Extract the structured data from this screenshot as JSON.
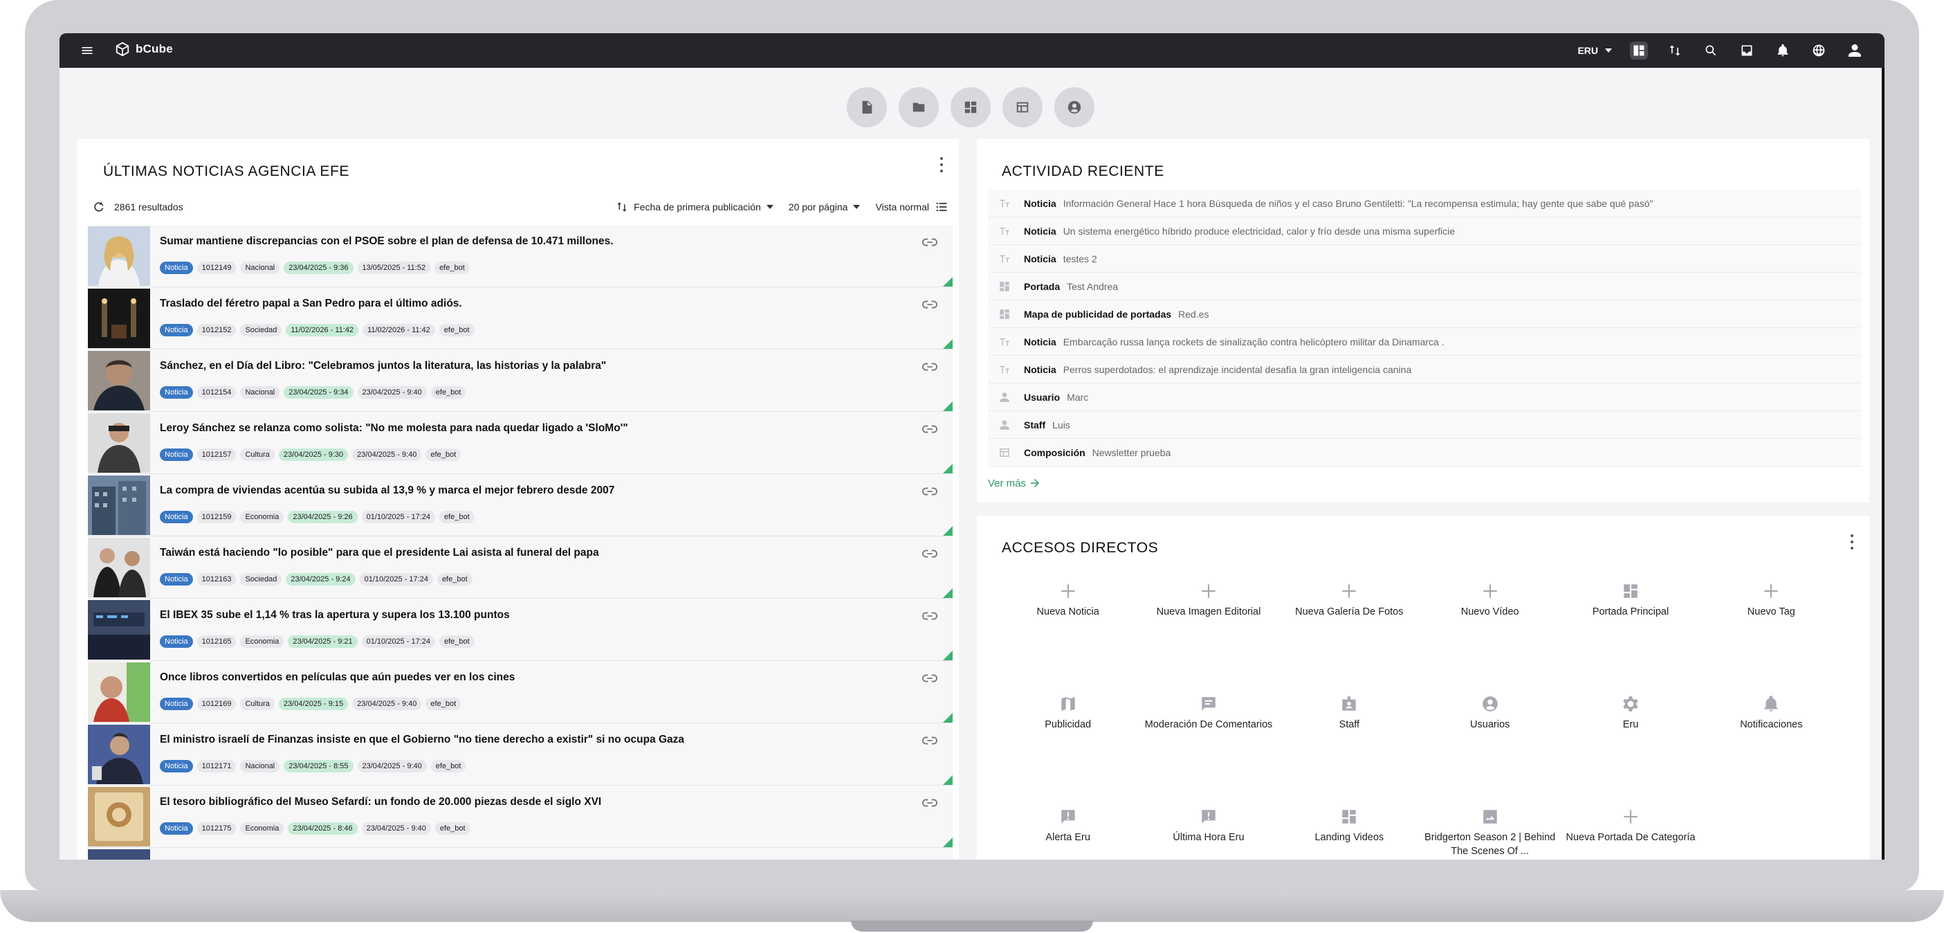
{
  "topbar": {
    "brand": "bCube",
    "site_selector": "ERU",
    "icons": [
      "layout-icon",
      "sort-icon",
      "search-icon",
      "inbox-icon",
      "bell-icon",
      "globe-icon",
      "account-icon"
    ]
  },
  "quick_buttons": [
    "document-icon",
    "folder-icon",
    "dashboard-icon",
    "table-icon",
    "user-circle-icon"
  ],
  "news": {
    "title": "ÚLTIMAS NOTICIAS AGENCIA EFE",
    "results": "2861 resultados",
    "sort_label": "Fecha de primera publicación",
    "per_page": "20 por página",
    "view": "Vista normal",
    "items": [
      {
        "title": "Sumar mantiene discrepancias con el PSOE sobre el plan de defensa de 10.471 millones.",
        "type": "Noticia",
        "id": "1012149",
        "section": "Nacional",
        "date1": "23/04/2025 - 9:36",
        "date2": "13/05/2025 - 11:52",
        "user": "efe_bot"
      },
      {
        "title": "Traslado del féretro papal a San Pedro para el último adiós.",
        "type": "Noticia",
        "id": "1012152",
        "section": "Sociedad",
        "date1": "11/02/2026 - 11:42",
        "date2": "11/02/2026 - 11:42",
        "user": "efe_bot"
      },
      {
        "title": "Sánchez, en el Día del Libro: \"Celebramos juntos la literatura, las historias y la palabra\"",
        "type": "Noticia",
        "id": "1012154",
        "section": "Nacional",
        "date1": "23/04/2025 - 9:34",
        "date2": "23/04/2025 - 9:40",
        "user": "efe_bot"
      },
      {
        "title": "Leroy Sánchez se relanza como solista: \"No me molesta para nada quedar ligado a 'SloMo'\"",
        "type": "Noticia",
        "id": "1012157",
        "section": "Cultura",
        "date1": "23/04/2025 - 9:30",
        "date2": "23/04/2025 - 9:40",
        "user": "efe_bot"
      },
      {
        "title": "La compra de viviendas acentúa su subida al 13,9 % y marca el mejor febrero desde 2007",
        "type": "Noticia",
        "id": "1012159",
        "section": "Economia",
        "date1": "23/04/2025 - 9:26",
        "date2": "01/10/2025 - 17:24",
        "user": "efe_bot"
      },
      {
        "title": "Taiwán está haciendo \"lo posible\" para que el presidente Lai asista al funeral del papa",
        "type": "Noticia",
        "id": "1012163",
        "section": "Sociedad",
        "date1": "23/04/2025 - 9:24",
        "date2": "01/10/2025 - 17:24",
        "user": "efe_bot"
      },
      {
        "title": "El IBEX 35 sube el 1,14 % tras la apertura y supera los 13.100 puntos",
        "type": "Noticia",
        "id": "1012165",
        "section": "Economia",
        "date1": "23/04/2025 - 9:21",
        "date2": "01/10/2025 - 17:24",
        "user": "efe_bot"
      },
      {
        "title": "Once libros convertidos en películas que aún puedes ver en los cines",
        "type": "Noticia",
        "id": "1012169",
        "section": "Cultura",
        "date1": "23/04/2025 - 9:15",
        "date2": "23/04/2025 - 9:40",
        "user": "efe_bot"
      },
      {
        "title": "El ministro israelí de Finanzas insiste en que el Gobierno \"no tiene derecho a existir\" si no ocupa Gaza",
        "type": "Noticia",
        "id": "1012171",
        "section": "Nacional",
        "date1": "23/04/2025 - 8:55",
        "date2": "23/04/2025 - 9:40",
        "user": "efe_bot"
      },
      {
        "title": "El tesoro bibliográfico del Museo Sefardí: un fondo de 20.000 piezas desde el siglo XVI",
        "type": "Noticia",
        "id": "1012175",
        "section": "Economia",
        "date1": "23/04/2025 - 8:46",
        "date2": "23/04/2025 - 9:40",
        "user": "efe_bot"
      }
    ]
  },
  "activity": {
    "title": "ACTIVIDAD RECIENTE",
    "rows": [
      {
        "icon": "text-icon",
        "kind": "Noticia",
        "desc": "Información General Hace 1 hora Búsqueda de niños y el caso Bruno Gentiletti: \"La recompensa estimula; hay gente que sabe qué pasó\""
      },
      {
        "icon": "text-icon",
        "kind": "Noticia",
        "desc": "Un sistema energético híbrido produce electricidad, calor y frío desde una misma superficie"
      },
      {
        "icon": "text-icon",
        "kind": "Noticia",
        "desc": "testes 2"
      },
      {
        "icon": "dashboard-icon",
        "kind": "Portada",
        "desc": "Test Andrea"
      },
      {
        "icon": "dashboard-icon",
        "kind": "Mapa de publicidad de portadas",
        "desc": "Red.es"
      },
      {
        "icon": "text-icon",
        "kind": "Noticia",
        "desc": "Embarcação russa lança rockets de sinalização contra helicóptero militar da Dinamarca ."
      },
      {
        "icon": "text-icon",
        "kind": "Noticia",
        "desc": "Perros superdotados: el aprendizaje incidental desafía la gran inteligencia canina"
      },
      {
        "icon": "person-icon",
        "kind": "Usuario",
        "desc": "Marc"
      },
      {
        "icon": "person-icon",
        "kind": "Staff",
        "desc": "Luis"
      },
      {
        "icon": "table-icon",
        "kind": "Composición",
        "desc": "Newsletter prueba"
      }
    ],
    "more": "Ver más"
  },
  "shortcuts": {
    "title": "ACCESOS DIRECTOS",
    "items": [
      {
        "icon": "plus-icon",
        "label": "Nueva Noticia"
      },
      {
        "icon": "plus-icon",
        "label": "Nueva Imagen Editorial"
      },
      {
        "icon": "plus-icon",
        "label": "Nueva Galería De Fotos"
      },
      {
        "icon": "plus-icon",
        "label": "Nuevo Vídeo"
      },
      {
        "icon": "dashboard-icon",
        "label": "Portada Principal"
      },
      {
        "icon": "plus-icon",
        "label": "Nuevo Tag"
      },
      {
        "icon": "map-icon",
        "label": "Publicidad"
      },
      {
        "icon": "comment-icon",
        "label": "Moderación De Comentarios"
      },
      {
        "icon": "badge-icon",
        "label": "Staff"
      },
      {
        "icon": "user-circle-icon",
        "label": "Usuarios"
      },
      {
        "icon": "gear-icon",
        "label": "Eru"
      },
      {
        "icon": "bell-icon",
        "label": "Notificaciones"
      },
      {
        "icon": "alert-icon",
        "label": "Alerta Eru"
      },
      {
        "icon": "alert-icon",
        "label": "Última Hora Eru"
      },
      {
        "icon": "dashboard-icon",
        "label": "Landing Videos"
      },
      {
        "icon": "image-icon",
        "label": "Bridgerton Season 2 | Behind The Scenes Of ..."
      },
      {
        "icon": "plus-icon",
        "label": "Nueva Portada De Categoría"
      }
    ]
  }
}
